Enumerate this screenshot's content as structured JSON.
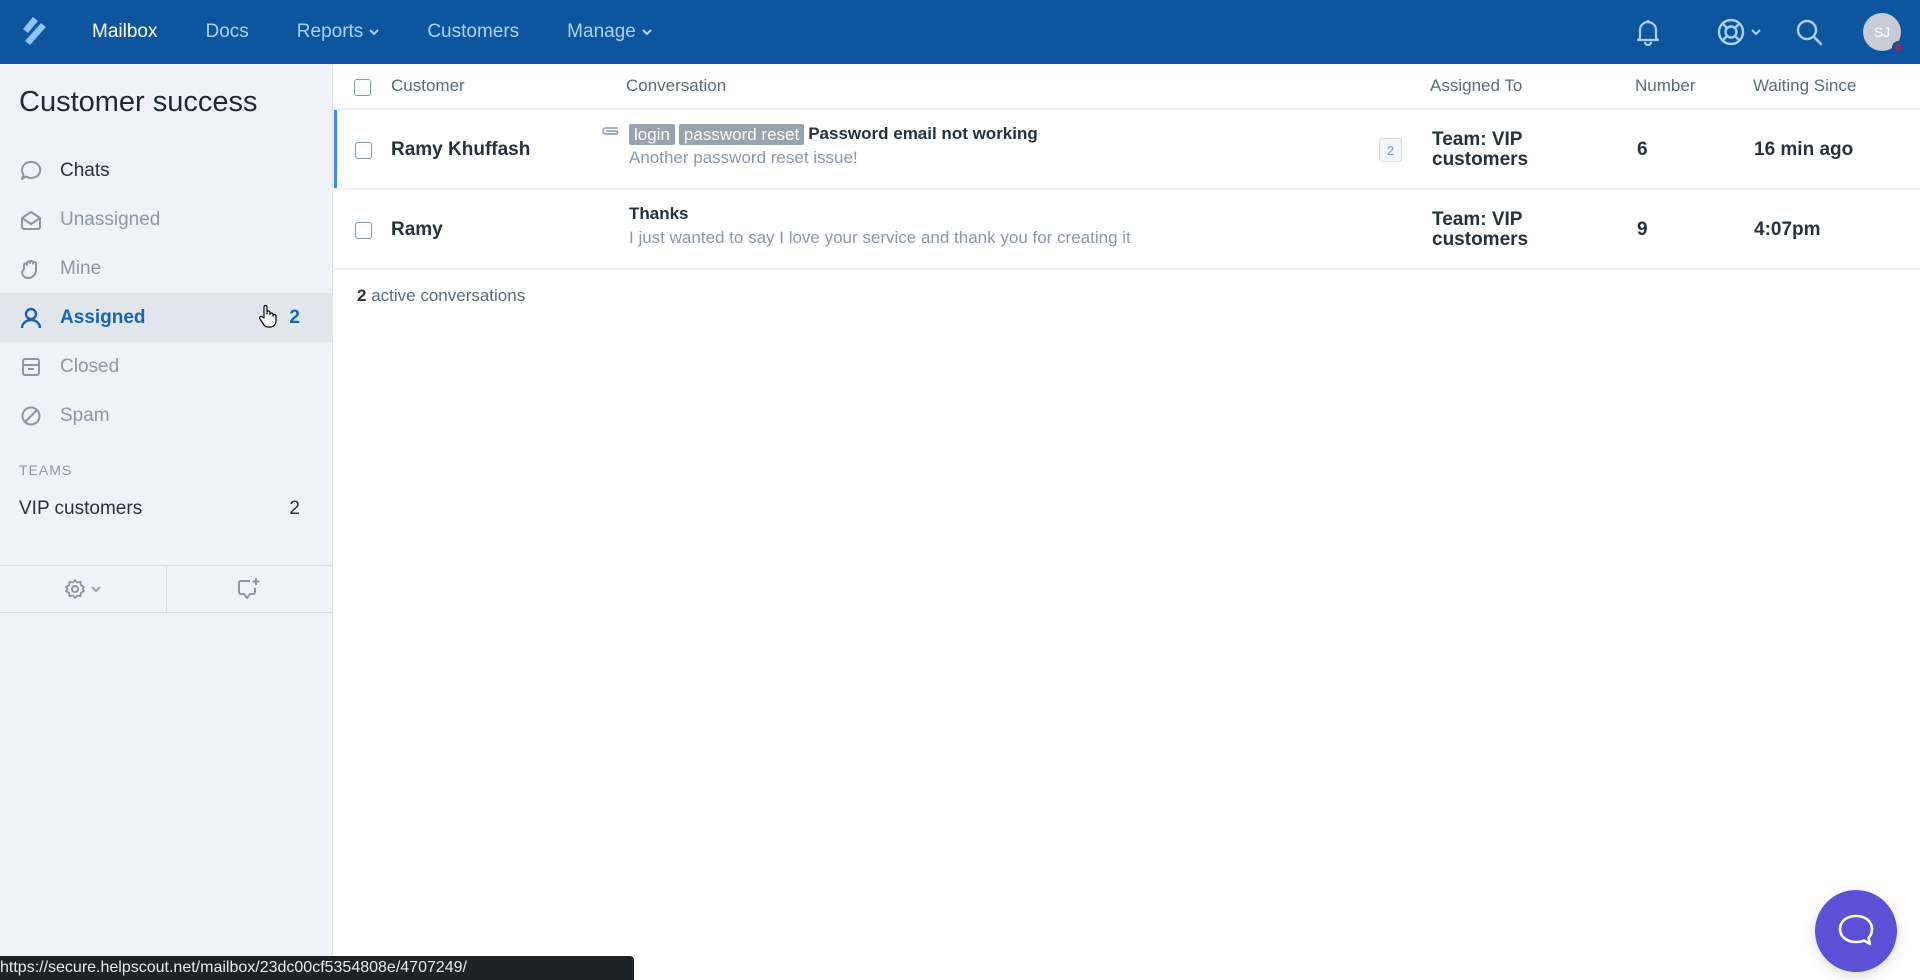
{
  "topnav": {
    "brand_color": "#0d559e",
    "items": [
      {
        "label": "Mailbox",
        "active": true,
        "has_dropdown": false
      },
      {
        "label": "Docs",
        "active": false,
        "has_dropdown": false
      },
      {
        "label": "Reports",
        "active": false,
        "has_dropdown": true
      },
      {
        "label": "Customers",
        "active": false,
        "has_dropdown": false
      },
      {
        "label": "Manage",
        "active": false,
        "has_dropdown": true
      }
    ],
    "right_icons": [
      "bell-icon",
      "help-lifebuoy-icon",
      "search-icon"
    ],
    "avatar": {
      "initials": "SJ",
      "status": "busy"
    }
  },
  "sidebar": {
    "mailbox_title": "Customer success",
    "folders": [
      {
        "label": "Chats",
        "icon": "chat-bubble-icon",
        "count": ""
      },
      {
        "label": "Unassigned",
        "icon": "envelope-open-icon",
        "count": ""
      },
      {
        "label": "Mine",
        "icon": "hand-icon",
        "count": ""
      },
      {
        "label": "Assigned",
        "icon": "user-icon",
        "count": "2",
        "active": true
      },
      {
        "label": "Closed",
        "icon": "archive-icon",
        "count": ""
      },
      {
        "label": "Spam",
        "icon": "ban-icon",
        "count": ""
      }
    ],
    "teams_heading": "TEAMS",
    "teams": [
      {
        "label": "VIP customers",
        "count": "2"
      }
    ],
    "footer": [
      "settings-gear-icon",
      "new-conversation-icon"
    ]
  },
  "table": {
    "columns": {
      "customer": "Customer",
      "conversation": "Conversation",
      "assigned_to": "Assigned To",
      "number": "Number",
      "waiting_since": "Waiting Since"
    },
    "rows": [
      {
        "customer": "Ramy Khuffash",
        "has_attachment": true,
        "tags": [
          "login",
          "password reset"
        ],
        "subject": "Password email not working",
        "preview": "Another password reset issue!",
        "thread_count": "2",
        "assigned_to": "Team: VIP customers",
        "number": "6",
        "waiting_since": "16 min ago",
        "selected": true
      },
      {
        "customer": "Ramy",
        "has_attachment": false,
        "tags": [],
        "subject": "Thanks",
        "preview": "I just wanted to say I love your service and thank you for creating it",
        "thread_count": "",
        "assigned_to": "Team: VIP customers",
        "number": "9",
        "waiting_since": "4:07pm",
        "selected": false
      }
    ],
    "summary_count": "2",
    "summary_text": " active conversations"
  },
  "statusbar": {
    "url": "https://secure.helpscout.net/mailbox/23dc00cf5354808e/4707249/"
  },
  "beacon": {
    "icon": "chat-bubble-icon",
    "color": "#5a51d6"
  }
}
